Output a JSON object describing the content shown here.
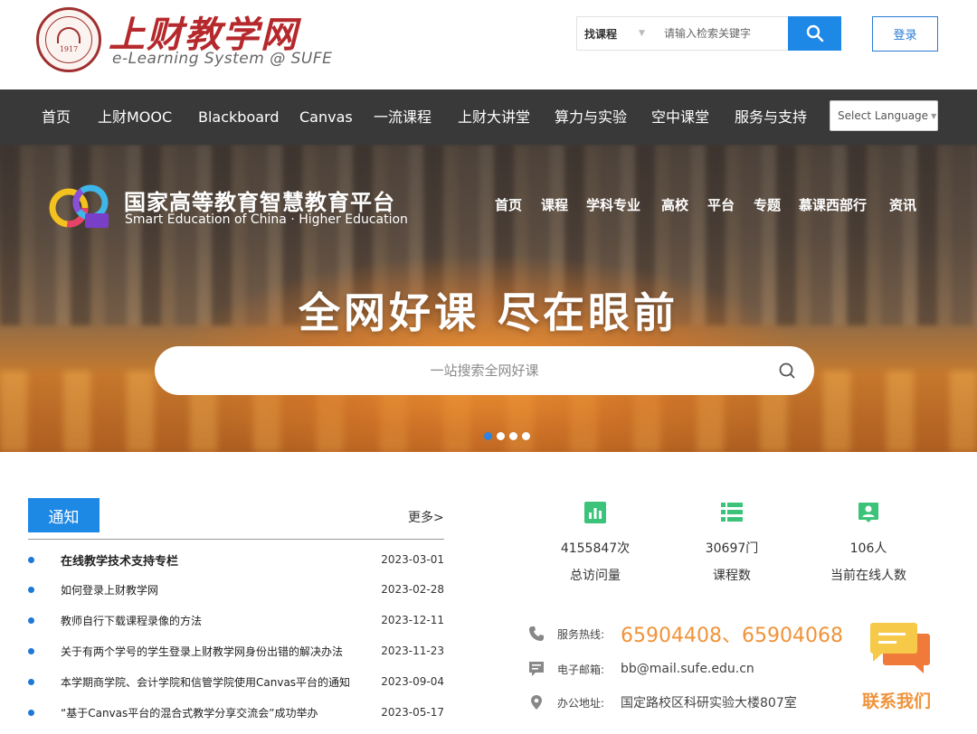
{
  "header": {
    "seal_year": "1917",
    "brand_title": "上财教学网",
    "brand_subtitle": "e-Learning System @ SUFE",
    "search_category": "找课程",
    "search_placeholder": "请输入检索关键字",
    "login_label": "登录"
  },
  "nav": {
    "items": [
      "首页",
      "上财MOOC",
      "Blackboard",
      "Canvas",
      "一流课程",
      "上财大讲堂",
      "算力与实验",
      "空中课堂",
      "服务与支持"
    ],
    "language_label": "Select Language"
  },
  "banner": {
    "platform_title": "国家高等教育智慧教育平台",
    "platform_subtitle": "Smart Education of China · Higher Education",
    "nav": [
      "首页",
      "课程",
      "学科专业",
      "高校",
      "平台",
      "专题",
      "慕课西部行",
      "资讯"
    ],
    "slogan": "全网好课 尽在眼前",
    "search_placeholder": "一站搜索全网好课",
    "slide_count": 4,
    "active_slide": 1
  },
  "notices": {
    "tab_label": "通知",
    "more_label": "更多>",
    "items": [
      {
        "title": "在线教学技术支持专栏",
        "date": "2023-03-01",
        "bold": true
      },
      {
        "title": "如何登录上财教学网",
        "date": "2023-02-28",
        "bold": false
      },
      {
        "title": "教师自行下载课程录像的方法",
        "date": "2023-12-11",
        "bold": false
      },
      {
        "title": "关于有两个学号的学生登录上财教学网身份出错的解决办法",
        "date": "2023-11-23",
        "bold": false
      },
      {
        "title": "本学期商学院、会计学院和信管学院使用Canvas平台的通知",
        "date": "2023-09-04",
        "bold": false
      },
      {
        "title": "“基于Canvas平台的混合式教学分享交流会”成功举办",
        "date": "2023-05-17",
        "bold": false
      }
    ]
  },
  "stats": [
    {
      "value": "4155847次",
      "label": "总访问量",
      "icon": "bar-chart-icon"
    },
    {
      "value": "30697门",
      "label": "课程数",
      "icon": "list-icon"
    },
    {
      "value": "106人",
      "label": "当前在线人数",
      "icon": "user-badge-icon"
    }
  ],
  "contact": {
    "hotline_label": "服务热线:",
    "hotline_value": "65904408、65904068",
    "email_label": "电子邮箱:",
    "email_value": "bb@mail.sufe.edu.cn",
    "address_label": "办公地址:",
    "address_value": "国定路校区科研实验大楼807室",
    "contact_us_label": "联系我们"
  },
  "colors": {
    "accent_blue": "#1e88e5",
    "brand_red": "#b5282c",
    "nav_bg": "#393939",
    "stat_green": "#3cc37a",
    "contact_orange": "#f0933a"
  }
}
